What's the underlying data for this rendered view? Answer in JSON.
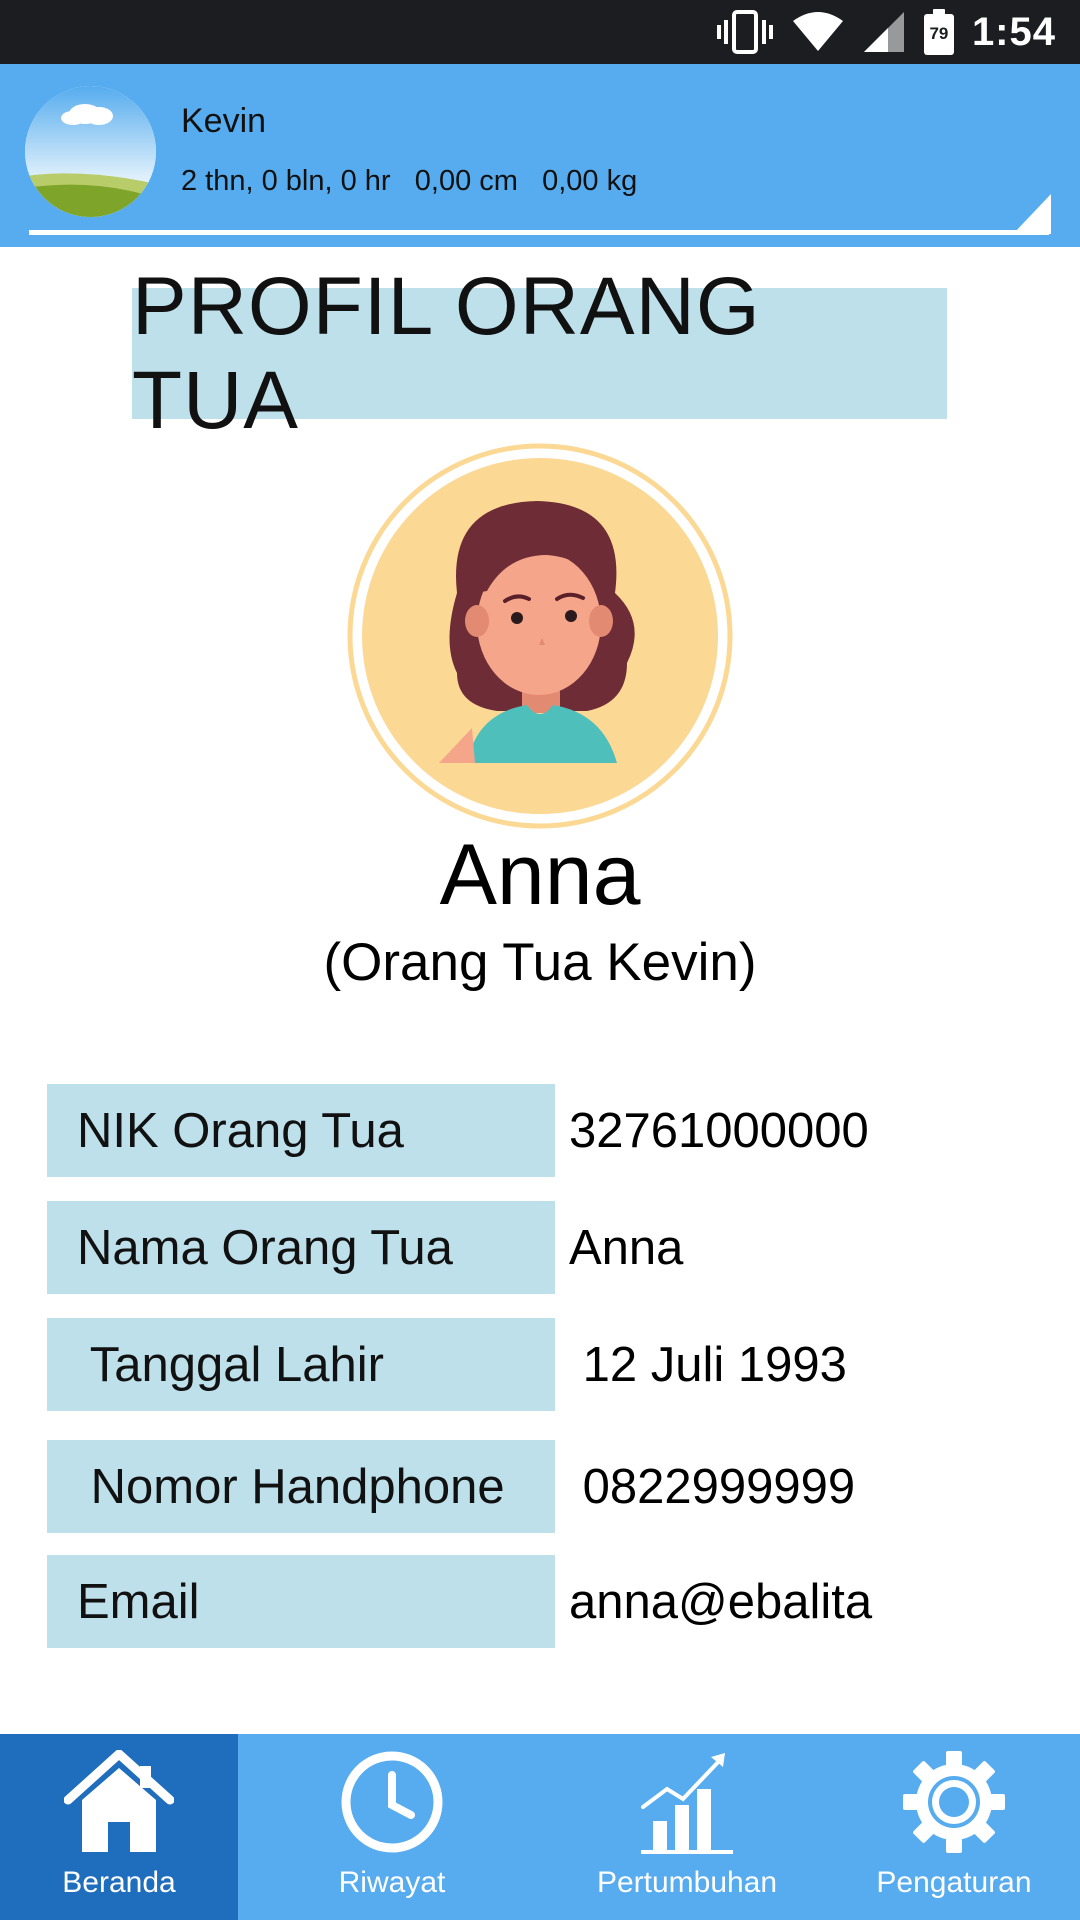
{
  "status_bar": {
    "battery": "79",
    "time": "1:54",
    "icons": [
      "vibrate-icon",
      "wifi-icon",
      "signal-icon",
      "battery-icon"
    ]
  },
  "child": {
    "name": "Kevin",
    "stats": "2 thn, 0 bln, 0 hr   0,00 cm   0,00 kg",
    "avatar_icon": "landscape-avatar-icon"
  },
  "page": {
    "title": "PROFIL ORANG TUA"
  },
  "parent": {
    "name": "Anna",
    "relation": "(Orang Tua Kevin)",
    "avatar_icon": "woman-avatar-icon"
  },
  "info_rows": [
    {
      "label": "NIK Orang Tua",
      "value": "32761000000"
    },
    {
      "label": "Nama Orang Tua",
      "value": "Anna"
    },
    {
      "label": " Tanggal Lahir",
      "value": " 12 Juli 1993"
    },
    {
      "label": " Nomor Handphone",
      "value": " 0822999999"
    },
    {
      "label": "Email",
      "value": "anna@ebalita"
    }
  ],
  "nav": {
    "items": [
      {
        "label": "Beranda",
        "icon": "home-icon",
        "active": true
      },
      {
        "label": "Riwayat",
        "icon": "clock-icon",
        "active": false
      },
      {
        "label": "Pertumbuhan",
        "icon": "growth-chart-icon",
        "active": false
      },
      {
        "label": "Pengaturan",
        "icon": "gear-icon",
        "active": false
      }
    ]
  },
  "colors": {
    "header_blue": "#56acee",
    "nav_active": "#1f6dbd",
    "label_bg": "#bde0eb",
    "avatar_bg": "#fbd995"
  }
}
